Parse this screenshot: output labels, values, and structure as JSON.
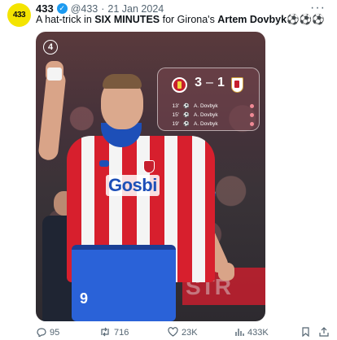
{
  "author": {
    "avatar_text": "433",
    "name": "433",
    "handle": "@433",
    "separator": "·",
    "date": "21 Jan 2024",
    "verified_icon": "verified-check-icon"
  },
  "tweet": {
    "text_1": "A hat-trick in ",
    "text_bold_1": "SIX MINUTES",
    "text_2": " for Girona's ",
    "text_bold_2": "Artem Dovbyk",
    "emoji": "⚽⚽⚽"
  },
  "more_icon": "···",
  "media": {
    "badge": "4",
    "sponsor": "Gosbi",
    "shirt_number": "9",
    "board_text": "STR",
    "scorecard": {
      "home_score": "3",
      "dash": "–",
      "away_score": "1",
      "goals": [
        {
          "minute": "13'",
          "scorer": "A. Dovbyk"
        },
        {
          "minute": "15'",
          "scorer": "A. Dovbyk"
        },
        {
          "minute": "19'",
          "scorer": "A. Dovbyk"
        }
      ]
    }
  },
  "actions": {
    "replies": "95",
    "retweets": "716",
    "likes": "23K",
    "views": "433K"
  },
  "colors": {
    "brand_yellow": "#f4e400",
    "verified_blue": "#1d9bf0",
    "girona_red": "#d71f2d"
  }
}
